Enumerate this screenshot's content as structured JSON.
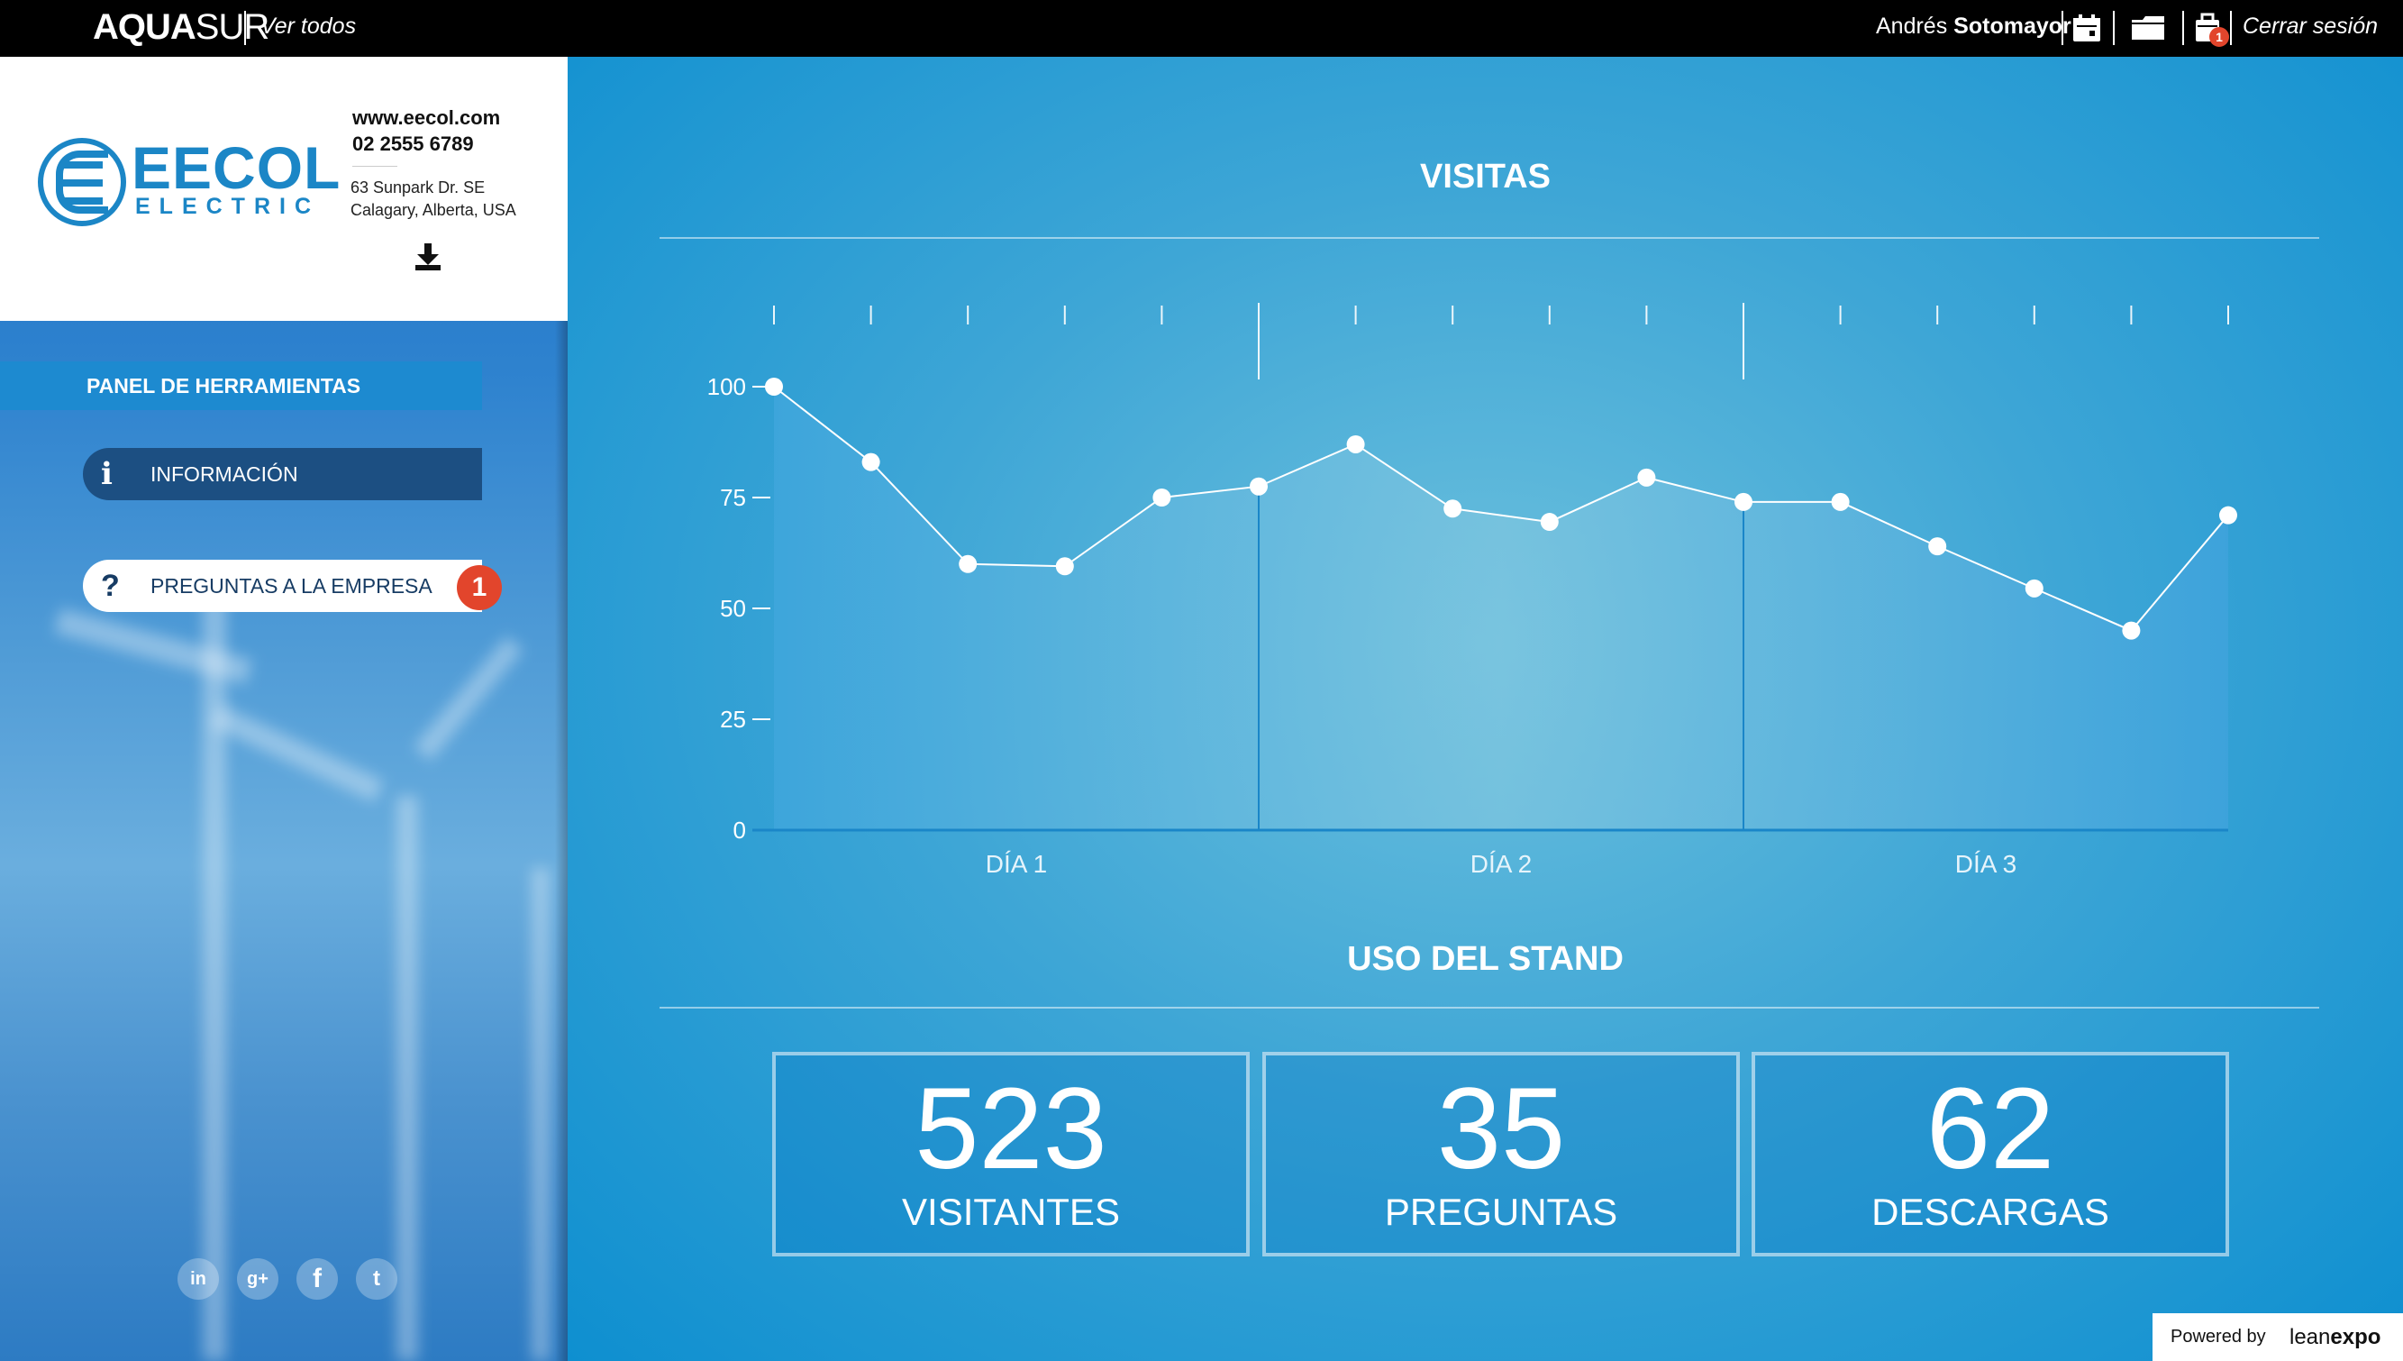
{
  "topbar": {
    "brand_bold": "AQUA",
    "brand_light": "SUR",
    "view_all": "Ver todos",
    "user_first": "Andrés",
    "user_last": "Sotomayor",
    "cart_badge": "1",
    "logout": "Cerrar sesión"
  },
  "company": {
    "logo_word": "EECOL",
    "logo_sub": "ELECTRIC",
    "website": "www.eecol.com",
    "phone": "02 2555 6789",
    "address_line1": "63 Sunpark Dr. SE",
    "address_line2": "Calagary, Alberta, USA"
  },
  "sidebar": {
    "panel_title": "PANEL DE HERRAMIENTAS",
    "items": [
      {
        "icon": "info-icon",
        "label": "INFORMACIÓN",
        "glyph": "i"
      },
      {
        "icon": "question-icon",
        "label": "PREGUNTAS A LA EMPRESA",
        "glyph": "?",
        "badge": "1"
      }
    ],
    "social": [
      {
        "icon": "linkedin-icon",
        "glyph": "in"
      },
      {
        "icon": "google-plus-icon",
        "glyph": "g+"
      },
      {
        "icon": "facebook-icon",
        "glyph": "f"
      },
      {
        "icon": "twitter-icon",
        "glyph": "t"
      }
    ]
  },
  "visits": {
    "title": "VISITAS"
  },
  "chart_data": {
    "type": "area",
    "title": "VISITAS",
    "ylim": [
      0,
      100
    ],
    "yticks": [
      0,
      25,
      50,
      75,
      100
    ],
    "day_labels": [
      "DÍA 1",
      "DÍA 2",
      "DÍA 3"
    ],
    "day_boundaries": [
      5,
      10
    ],
    "values": [
      100,
      83,
      60,
      59.5,
      75,
      77.5,
      87,
      72.5,
      69.5,
      79.5,
      74,
      74,
      64,
      54.5,
      45,
      71
    ],
    "grid": false
  },
  "usage": {
    "title": "USO DEL STAND",
    "stats": [
      {
        "value": "523",
        "label": "VISITANTES"
      },
      {
        "value": "35",
        "label": "PREGUNTAS"
      },
      {
        "value": "62",
        "label": "DESCARGAS"
      }
    ]
  },
  "footer": {
    "powered_by": "Powered by",
    "vendor_light": "lean",
    "vendor_bold": "expo"
  }
}
